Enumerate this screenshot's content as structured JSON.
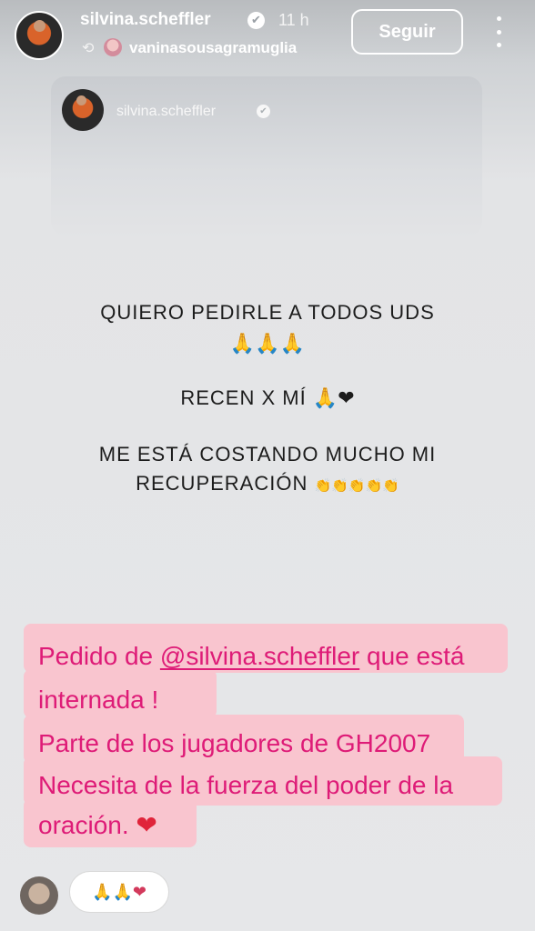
{
  "header": {
    "username": "silvina.scheffler",
    "time": "11 h",
    "reposted_by": "vaninasousagramuglia",
    "follow_label": "Seguir",
    "verified_glyph": "✔",
    "repost_glyph": "⟲"
  },
  "embedded_post": {
    "username": "silvina.scheffler",
    "verified_glyph": "✔"
  },
  "story_text": {
    "line1": "QUIERO PEDIRLE A TODOS UDS",
    "line1_emoji": "🙏🙏🙏",
    "line2": "RECEN X MÍ",
    "line2_emoji": "🙏❤",
    "line3": "ME ESTÁ COSTANDO MUCHO MI",
    "line4": "RECUPERACIÓN",
    "line4_emoji": "👏👏👏👏👏"
  },
  "caption": {
    "prefix": "Pedido de ",
    "mention": "@silvina.scheffler",
    "suffix": " que está",
    "line2": "internada !",
    "line3": "Parte de los jugadores de GH2007",
    "line4": "Necesita de la fuerza del poder de la",
    "line5": "oración.",
    "line5_emoji": "❤",
    "highlight_color": "#f9c5cf",
    "text_color": "#de1b77"
  },
  "reaction": {
    "text": "🙏🙏❤"
  },
  "icons": {
    "more": "more-options-icon",
    "repost": "repost-icon"
  }
}
